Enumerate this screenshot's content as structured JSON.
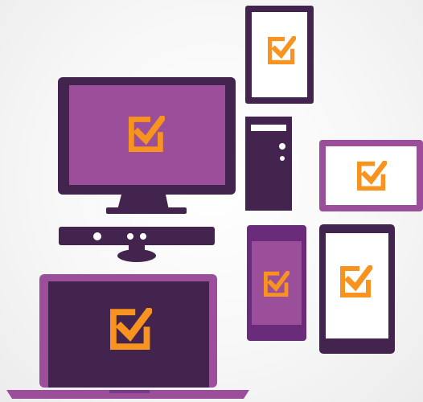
{
  "colors": {
    "dark_purple": "#43244f",
    "purple": "#8b3f8f",
    "light_purple": "#9b4f9b",
    "orange": "#f7931e",
    "white": "#ffffff"
  },
  "devices": [
    {
      "name": "tablet-portrait",
      "icon": "checkbox-checked-icon"
    },
    {
      "name": "desktop-monitor",
      "icon": "checkbox-checked-icon"
    },
    {
      "name": "desktop-tower",
      "icon": "none"
    },
    {
      "name": "tablet-landscape",
      "icon": "checkbox-checked-icon"
    },
    {
      "name": "kinect-sensor",
      "icon": "none"
    },
    {
      "name": "windows-phone",
      "icon": "checkbox-checked-icon"
    },
    {
      "name": "smartphone",
      "icon": "checkbox-checked-icon"
    },
    {
      "name": "laptop",
      "icon": "checkbox-checked-icon"
    }
  ]
}
